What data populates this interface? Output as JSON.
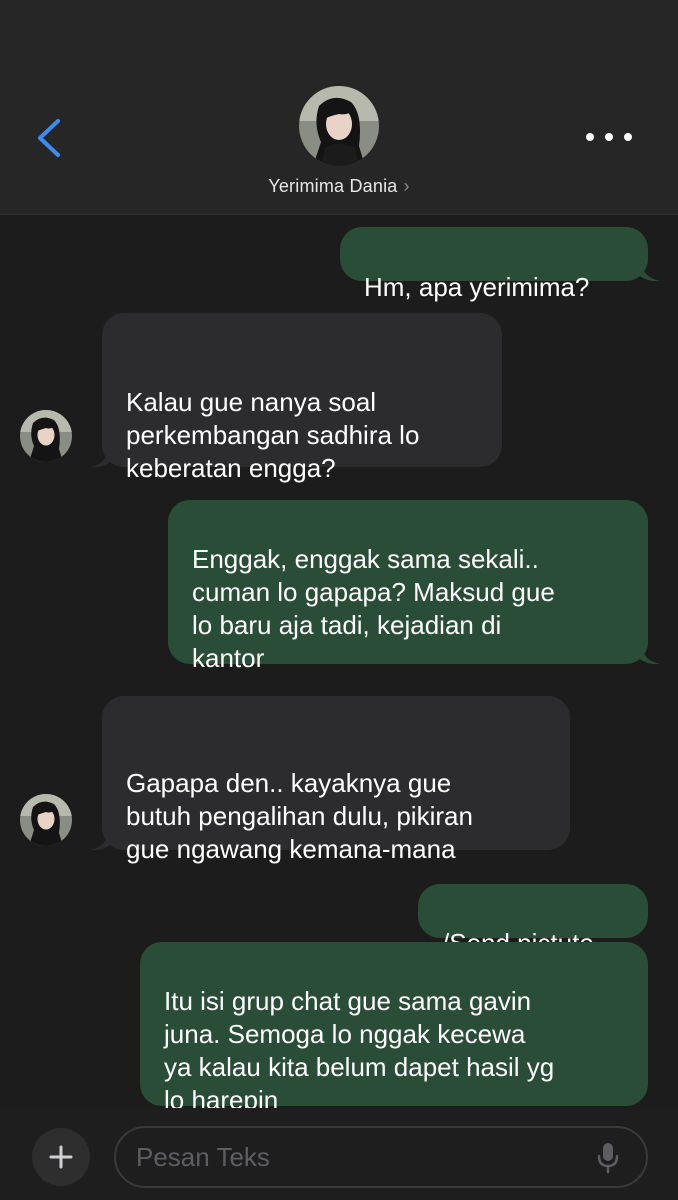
{
  "header": {
    "contact_name": "Yerimima Dania",
    "name_chevron": "›",
    "back_icon": "chevron-left-icon",
    "more_icon": "ellipsis-icon"
  },
  "colors": {
    "background": "#1c1c1c",
    "header_bg": "#262626",
    "outgoing_bubble": "#2a4d37",
    "incoming_bubble": "#2c2c2e",
    "accent_blue": "#3d8cf4"
  },
  "messages": [
    {
      "direction": "outgoing",
      "text": "Hm, apa yerimima?"
    },
    {
      "direction": "incoming",
      "text": "Kalau gue nanya soal\nperkembangan sadhira lo\nkeberatan engga?"
    },
    {
      "direction": "outgoing",
      "text": "Enggak, enggak sama sekali..\ncuman lo gapapa? Maksud gue\nlo baru aja tadi, kejadian di\nkantor"
    },
    {
      "direction": "incoming",
      "text": "Gapapa den.. kayaknya gue\nbutuh pengalihan dulu, pikiran\ngue ngawang kemana-mana"
    },
    {
      "direction": "outgoing",
      "text": "/Send pictute"
    },
    {
      "direction": "outgoing",
      "text": "Itu isi grup chat gue sama gavin\njuna. Semoga lo nggak kecewa\nya kalau kita belum dapet hasil yg\nlo harepin"
    }
  ],
  "composer": {
    "placeholder": "Pesan Teks",
    "add_icon": "plus-icon",
    "mic_icon": "microphone-icon"
  }
}
